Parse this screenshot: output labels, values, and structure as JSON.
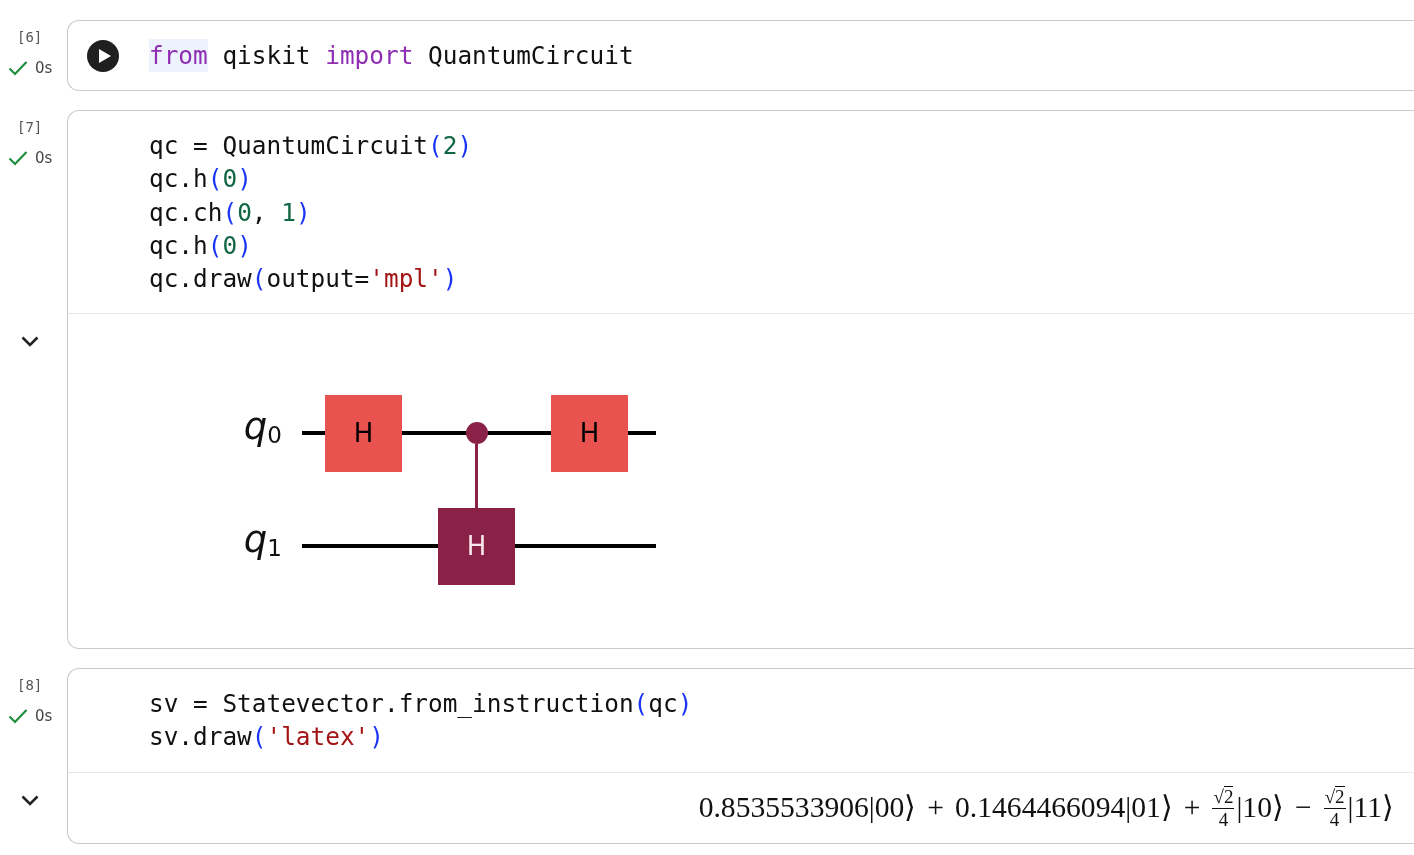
{
  "cells": [
    {
      "execution_count": "[6]",
      "status": {
        "kind": "success",
        "time": "0s"
      },
      "run_button": true,
      "code": [
        {
          "tokens": [
            {
              "text": "from",
              "kind": "keyword",
              "highlighted": true
            },
            {
              "text": " qiskit ",
              "kind": "plain",
              "highlighted": false
            },
            {
              "text": "import",
              "kind": "keyword",
              "highlighted": false
            },
            {
              "text": " QuantumCircuit",
              "kind": "plain",
              "highlighted": false
            }
          ]
        }
      ]
    },
    {
      "execution_count": "[7]",
      "status": {
        "kind": "success",
        "time": "0s"
      },
      "run_button": false,
      "code": [
        {
          "tokens": [
            {
              "text": "qc = QuantumCircuit",
              "kind": "plain",
              "highlighted": false
            },
            {
              "text": "(",
              "kind": "paren",
              "highlighted": false
            },
            {
              "text": "2",
              "kind": "number",
              "highlighted": false
            },
            {
              "text": ")",
              "kind": "paren",
              "highlighted": false
            }
          ]
        },
        {
          "tokens": [
            {
              "text": "qc.h",
              "kind": "plain",
              "highlighted": false
            },
            {
              "text": "(",
              "kind": "paren",
              "highlighted": false
            },
            {
              "text": "0",
              "kind": "number",
              "highlighted": false
            },
            {
              "text": ")",
              "kind": "paren",
              "highlighted": false
            }
          ]
        },
        {
          "tokens": [
            {
              "text": "qc.ch",
              "kind": "plain",
              "highlighted": false
            },
            {
              "text": "(",
              "kind": "paren",
              "highlighted": false
            },
            {
              "text": "0",
              "kind": "number",
              "highlighted": false
            },
            {
              "text": ", ",
              "kind": "plain",
              "highlighted": false
            },
            {
              "text": "1",
              "kind": "number",
              "highlighted": false
            },
            {
              "text": ")",
              "kind": "paren",
              "highlighted": false
            }
          ]
        },
        {
          "tokens": [
            {
              "text": "qc.h",
              "kind": "plain",
              "highlighted": false
            },
            {
              "text": "(",
              "kind": "paren",
              "highlighted": false
            },
            {
              "text": "0",
              "kind": "number",
              "highlighted": false
            },
            {
              "text": ")",
              "kind": "paren",
              "highlighted": false
            }
          ]
        },
        {
          "tokens": [
            {
              "text": "qc.draw",
              "kind": "plain",
              "highlighted": false
            },
            {
              "text": "(",
              "kind": "paren",
              "highlighted": false
            },
            {
              "text": "output=",
              "kind": "plain",
              "highlighted": false
            },
            {
              "text": "'mpl'",
              "kind": "string",
              "highlighted": false
            },
            {
              "text": ")",
              "kind": "paren",
              "highlighted": false
            }
          ]
        }
      ],
      "output": {
        "kind": "circuit",
        "qubits": [
          {
            "name": "q",
            "subscript": "0"
          },
          {
            "name": "q",
            "subscript": "1"
          }
        ],
        "columns": [
          {
            "cells": [
              {
                "kind": "gate",
                "label": "H"
              },
              {
                "kind": "wire"
              }
            ]
          },
          {
            "cells": [
              {
                "kind": "control"
              },
              {
                "kind": "controlled-gate",
                "label": "H"
              }
            ]
          },
          {
            "cells": [
              {
                "kind": "gate",
                "label": "H"
              },
              {
                "kind": "wire"
              }
            ]
          }
        ]
      }
    },
    {
      "execution_count": "[8]",
      "status": {
        "kind": "success",
        "time": "0s"
      },
      "run_button": false,
      "code": [
        {
          "tokens": [
            {
              "text": "sv = Statevector.from_instruction",
              "kind": "plain",
              "highlighted": false
            },
            {
              "text": "(",
              "kind": "paren",
              "highlighted": false
            },
            {
              "text": "qc",
              "kind": "plain",
              "highlighted": false
            },
            {
              "text": ")",
              "kind": "paren",
              "highlighted": false
            }
          ]
        },
        {
          "tokens": [
            {
              "text": "sv.draw",
              "kind": "plain",
              "highlighted": false
            },
            {
              "text": "(",
              "kind": "paren",
              "highlighted": false
            },
            {
              "text": "'latex'",
              "kind": "string",
              "highlighted": false
            },
            {
              "text": ")",
              "kind": "paren",
              "highlighted": false
            }
          ]
        }
      ],
      "output": {
        "kind": "latex",
        "equation": [
          {
            "kind": "number",
            "text": "0.8535533906"
          },
          {
            "kind": "ket",
            "text": "|00⟩"
          },
          {
            "kind": "operator",
            "text": "+"
          },
          {
            "kind": "number",
            "text": "0.1464466094"
          },
          {
            "kind": "ket",
            "text": "|01⟩"
          },
          {
            "kind": "operator",
            "text": "+"
          },
          {
            "kind": "fraction",
            "root": "√",
            "radicand": "2",
            "denominator": "4"
          },
          {
            "kind": "ket",
            "text": "|10⟩"
          },
          {
            "kind": "operator",
            "text": "−"
          },
          {
            "kind": "fraction",
            "root": "√",
            "radicand": "2",
            "denominator": "4"
          },
          {
            "kind": "ket",
            "text": "|11⟩"
          }
        ]
      }
    }
  ]
}
